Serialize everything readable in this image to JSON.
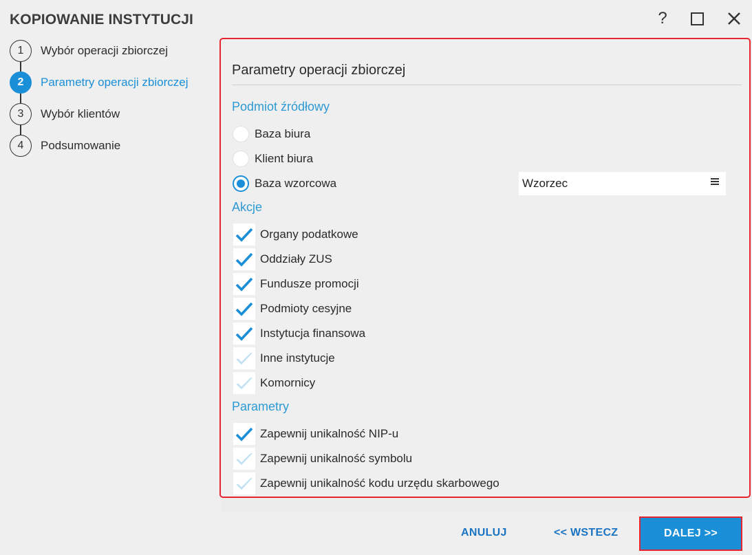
{
  "window": {
    "title": "KOPIOWANIE INSTYTUCJI",
    "help_label": "?"
  },
  "steps": [
    {
      "number": "1",
      "label": "Wybór operacji zbiorczej",
      "active": false
    },
    {
      "number": "2",
      "label": "Parametry operacji zbiorczej",
      "active": true
    },
    {
      "number": "3",
      "label": "Wybór klientów",
      "active": false
    },
    {
      "number": "4",
      "label": "Podsumowanie",
      "active": false
    }
  ],
  "panel": {
    "title": "Parametry operacji zbiorczej",
    "source_section": "Podmiot źródłowy",
    "source_options": [
      {
        "label": "Baza biura",
        "selected": false
      },
      {
        "label": "Klient biura",
        "selected": false
      },
      {
        "label": "Baza wzorcowa",
        "selected": true
      }
    ],
    "template_select": {
      "value": "Wzorzec"
    },
    "actions_section": "Akcje",
    "actions": [
      {
        "label": "Organy podatkowe",
        "checked": true
      },
      {
        "label": "Oddziały ZUS",
        "checked": true
      },
      {
        "label": "Fundusze promocji",
        "checked": true
      },
      {
        "label": "Podmioty cesyjne",
        "checked": true
      },
      {
        "label": "Instytucja finansowa",
        "checked": true
      },
      {
        "label": "Inne instytucje",
        "checked": false
      },
      {
        "label": "Komornicy",
        "checked": false
      }
    ],
    "params_section": "Parametry",
    "params": [
      {
        "label": "Zapewnij unikalność NIP-u",
        "checked": true
      },
      {
        "label": "Zapewnij unikalność symbolu",
        "checked": false
      },
      {
        "label": "Zapewnij unikalność kodu urzędu skarbowego",
        "checked": false
      }
    ]
  },
  "footer": {
    "cancel_label": "ANULUJ",
    "back_label": "<< WSTECZ",
    "next_label": "DALEJ >>"
  },
  "colors": {
    "accent": "#1a8fd8",
    "section": "#2d9ad3",
    "highlight_border": "#e8232e",
    "check_on": "#1a8fd8",
    "check_off": "#bfe0f3"
  },
  "icons": {
    "help": "help-icon",
    "maximize": "maximize-icon",
    "close": "close-icon",
    "select_menu": "menu-icon",
    "check": "checkmark-icon"
  }
}
